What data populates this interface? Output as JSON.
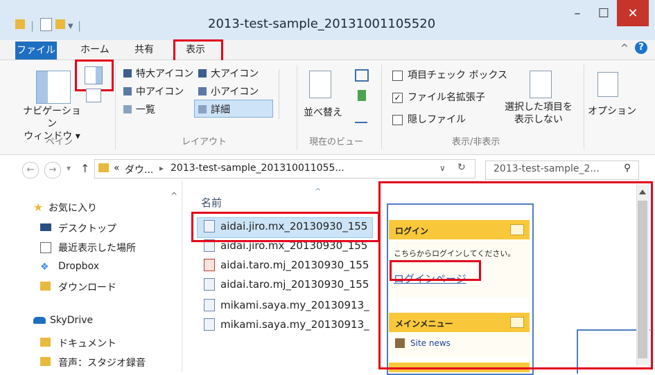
{
  "window": {
    "title": "2013-test-sample_20131001105520",
    "minimize": "–",
    "maximize": "☐",
    "close": "✕",
    "qat_pipe1": "|",
    "qat_pipe2": "|",
    "qat_dropdown": "▾"
  },
  "ribbon": {
    "tabs": [
      "ファイル",
      "ホーム",
      "共有",
      "表示"
    ],
    "collapse": "^",
    "help": "?",
    "pane": {
      "navpane_label": "ナビゲーション\nウィンドウ ▾",
      "group_label": "ペイン"
    },
    "layout": {
      "items": [
        "特大アイコン",
        "大アイコン",
        "中アイコン",
        "小アイコン",
        "一覧",
        "詳細"
      ],
      "group_label": "レイアウト"
    },
    "current_view": {
      "sort_label": "並べ替え",
      "group_label": "現在のビュー"
    },
    "show_hide": {
      "item_checkboxes": "項目チェック ボックス",
      "file_extensions": "ファイル名拡張子",
      "hidden_items": "隠しファイル",
      "hide_selected": "選択した項目を\n表示しない",
      "group_label": "表示/非表示"
    },
    "options_label": "オプション"
  },
  "address": {
    "back": "←",
    "forward": "→",
    "recent": "▾",
    "up": "↑",
    "path_prefix": "«",
    "path_part1": "ダウ...",
    "path_sep": "▸",
    "path_part2": "2013-test-sample_201310011055...",
    "dropdown": "∨",
    "refresh": "↻",
    "search_text": "2013-test-sample_2...",
    "search_icon": "⚲"
  },
  "nav": {
    "scroll_up": "^",
    "favorites": "お気に入り",
    "items": [
      "デスクトップ",
      "最近表示した場所",
      "Dropbox",
      "ダウンロード"
    ],
    "skydrive": "SkyDrive",
    "sky_items": [
      "ドキュメント",
      "音声：スタジオ録音"
    ]
  },
  "files": {
    "header_name": "名前",
    "sort_arrow": "^",
    "rows": [
      "aidai.jiro.mx_20130930_155",
      "aidai.jiro.mx_20130930_155",
      "aidai.taro.mj_20130930_155",
      "aidai.taro.mj_20130930_155",
      "mikami.saya.my_20130913_",
      "mikami.saya.my_20130913_"
    ]
  },
  "preview": {
    "login_title": "ログイン",
    "login_prompt": "こちらからログインしてください。",
    "login_link": "ログインページ",
    "menu_title": "メインメニュー",
    "menu_item": "Site news"
  },
  "colors": {
    "titlebar": "#1e74c9",
    "close": "#c7342a",
    "highlight": "#e3001b",
    "preview_header": "#f8c83a"
  }
}
